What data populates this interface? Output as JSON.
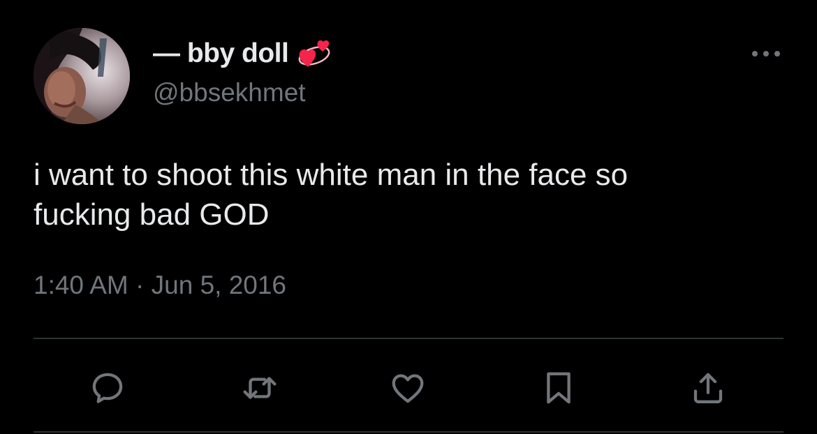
{
  "user": {
    "display_name": "— bby doll",
    "emoji": "revolving-hearts-emoji",
    "handle": "@bbsekhmet"
  },
  "tweet": {
    "text": "i want to shoot this white man in the face so\nfucking bad GOD",
    "timestamp": "1:40 AM · Jun 5, 2016"
  },
  "actions": [
    {
      "icon": "reply-icon"
    },
    {
      "icon": "retweet-icon"
    },
    {
      "icon": "like-icon"
    },
    {
      "icon": "bookmark-icon"
    },
    {
      "icon": "share-icon"
    }
  ],
  "colors": {
    "background": "#000000",
    "primary_text": "#e7e9ea",
    "secondary_text": "#71767b",
    "divider": "#2f3336",
    "heart": "#f4244b"
  }
}
